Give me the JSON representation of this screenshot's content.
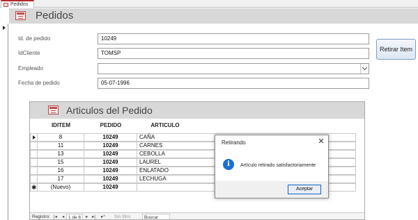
{
  "tab": {
    "label": "Pedidos"
  },
  "form": {
    "title": "Pedidos",
    "fields": {
      "id_pedido": {
        "label": "Id. de pedido",
        "value": "10249"
      },
      "id_cliente": {
        "label": "IdCliente",
        "value": "TOMSP"
      },
      "empleado": {
        "label": "Empleado",
        "value": ""
      },
      "fecha": {
        "label": "Fecha de pedido",
        "value": "05-07-1996"
      }
    },
    "retirar_button": "Retirar Item"
  },
  "subform": {
    "title": "Articulos del Pedido",
    "columns": [
      "IDITEM",
      "PEDIDO",
      "ARTICULO"
    ],
    "rows": [
      {
        "iditem": "8",
        "pedido": "10249",
        "articulo": "CAÑA"
      },
      {
        "iditem": "11",
        "pedido": "10249",
        "articulo": "CARNES"
      },
      {
        "iditem": "13",
        "pedido": "10249",
        "articulo": "CEBOLLA"
      },
      {
        "iditem": "15",
        "pedido": "10249",
        "articulo": "LAUREL"
      },
      {
        "iditem": "16",
        "pedido": "10249",
        "articulo": "ENLATADO"
      },
      {
        "iditem": "17",
        "pedido": "10249",
        "articulo": "LECHUGA"
      }
    ],
    "new_row": {
      "iditem": "(Nuevo)",
      "pedido": "10249",
      "articulo": ""
    },
    "nav": {
      "label": "Registro:",
      "first": "|◂",
      "prev": "◂",
      "position": "1 de 6",
      "next": "▸",
      "last": "▸|",
      "new": "▸*",
      "filter": "Sin filtro",
      "search": "Buscar"
    }
  },
  "dialog": {
    "title": "Retirando",
    "close": "✕",
    "icon": "info-icon",
    "message": "Artículo retirado satisfactoriamente",
    "ok_button": "Aceptar"
  },
  "colors": {
    "accent": "#b22b2b",
    "header_bg": "#d8d8d8",
    "info_blue": "#1c6fd1"
  }
}
